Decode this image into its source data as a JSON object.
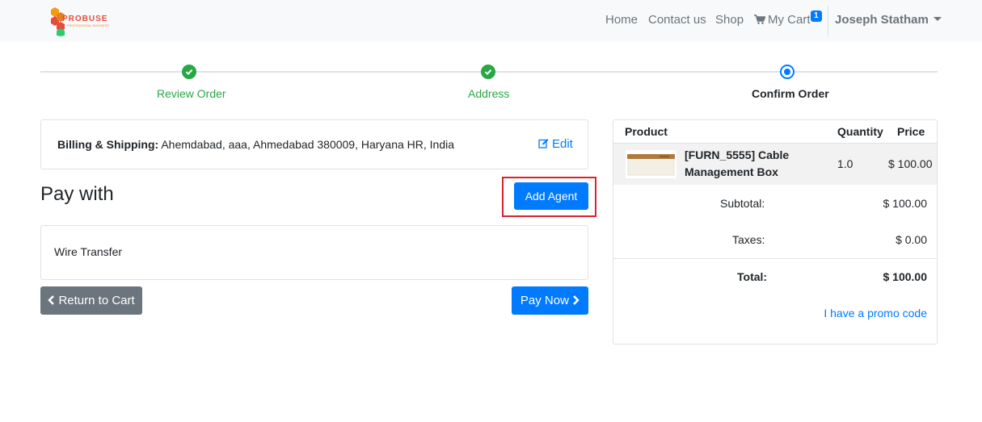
{
  "navbar": {
    "logo_text": "PROBUSE",
    "logo_tagline": "PROFESSIONAL BUSINESS",
    "links": {
      "home": "Home",
      "contact": "Contact us",
      "shop": "Shop",
      "cart": "My Cart"
    },
    "cart_count": "1",
    "user_name": "Joseph Statham"
  },
  "wizard": {
    "steps": [
      {
        "label": "Review Order",
        "state": "done"
      },
      {
        "label": "Address",
        "state": "done"
      },
      {
        "label": "Confirm Order",
        "state": "current"
      }
    ]
  },
  "billing": {
    "label": "Billing & Shipping:",
    "address": "Ahemdabad, aaa, Ahmedabad 380009, Haryana HR, India",
    "edit_label": "Edit"
  },
  "payment": {
    "heading": "Pay with",
    "add_agent_label": "Add Agent",
    "method": "Wire Transfer",
    "return_label": "Return to Cart",
    "pay_now_label": "Pay Now"
  },
  "summary": {
    "headers": {
      "product": "Product",
      "quantity": "Quantity",
      "price": "Price"
    },
    "items": [
      {
        "name": "[FURN_5555] Cable Management Box",
        "quantity": "1.0",
        "price": "$ 100.00"
      }
    ],
    "subtotal_label": "Subtotal:",
    "subtotal": "$ 100.00",
    "taxes_label": "Taxes:",
    "taxes": "$ 0.00",
    "total_label": "Total:",
    "total": "$ 100.00",
    "promo_label": "I have a promo code"
  },
  "colors": {
    "primary": "#007bff",
    "success": "#28a745",
    "secondary": "#6c757d",
    "highlight": "#d9232d"
  }
}
